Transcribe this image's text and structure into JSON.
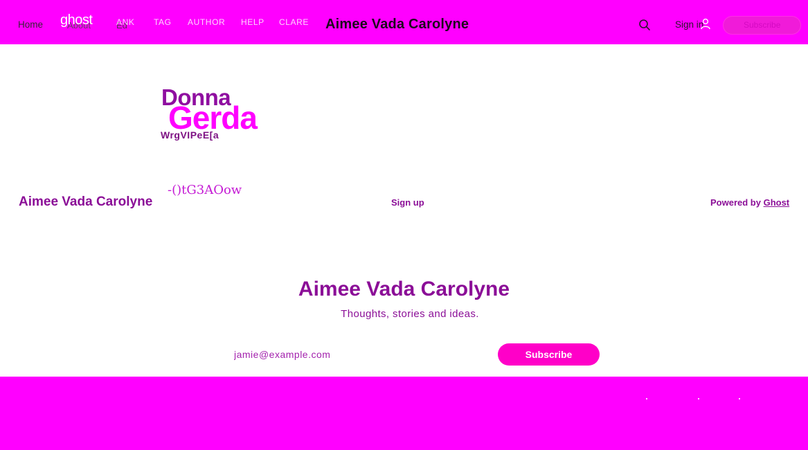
{
  "header": {
    "home_label": "Home",
    "logo_text": "ghost",
    "about_label": "About",
    "about_suffix": "Ed",
    "nav_links": [
      "ANK",
      "TAG",
      "AUTHOR",
      "HELP",
      "CLARE"
    ],
    "site_title": "Aimee Vada Carolyne",
    "search_icon": "search-icon",
    "signin_label": "Sign in",
    "user_icon": "user-icon",
    "subscribe_label": "Subscribe",
    "accent_color": "#ff00ff"
  },
  "hero": {
    "name_primary": "Donna",
    "name_secondary": "Gerda",
    "garbled_line_1": "WrgVIPeE[a",
    "garbled_line_2": "-()tG3AOow"
  },
  "footer_row": {
    "title": "Aimee Vada Carolyne",
    "signup_label": "Sign up",
    "powered_prefix": "Powered by ",
    "powered_link": "Ghost"
  },
  "cta": {
    "title": "Aimee Vada Carolyne",
    "subtitle": "Thoughts, stories and ideas.",
    "email_placeholder": "jamie@example.com",
    "button_label": "Subscribe",
    "button_color": "#ff00c8"
  }
}
